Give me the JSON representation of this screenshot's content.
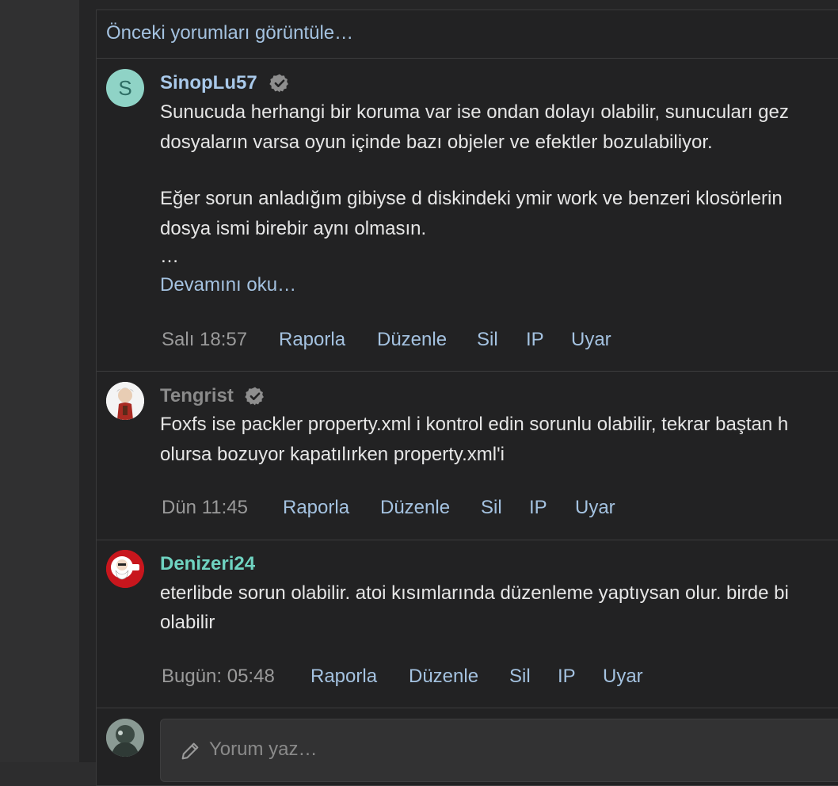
{
  "thread": {
    "previous_comments_link": "Önceki yorumları görüntüle…"
  },
  "comments": [
    {
      "username": "SinopLu57",
      "username_color": "#a9c9ea",
      "avatar_letter": "S",
      "verified": true,
      "body_lines": [
        "Sunucuda herhangi bir koruma var ise ondan dolayı olabilir, sunucuları gez",
        "dosyaların varsa oyun içinde bazı objeler ve efektler bozulabiliyor.",
        "Eğer sorun anladığım gibiyse d diskindeki ymir work ve benzeri klosörlerin",
        "dosya ismi birebir aynı olmasın.",
        "…"
      ],
      "read_more": "Devamını oku…",
      "time": "Salı 18:57",
      "actions": [
        "Raporla",
        "Düzenle",
        "Sil",
        "IP",
        "Uyar"
      ]
    },
    {
      "username": "Tengrist",
      "username_color": "#8a8a8a",
      "verified": true,
      "body_lines": [
        "Foxfs ise packler property.xml i kontrol edin sorunlu olabilir, tekrar baştan h",
        "olursa bozuyor kapatılırken property.xml'i"
      ],
      "time": "Dün 11:45",
      "actions": [
        "Raporla",
        "Düzenle",
        "Sil",
        "IP",
        "Uyar"
      ]
    },
    {
      "username": "Denizeri24",
      "username_color": "#6fd3c1",
      "verified": false,
      "body_lines": [
        "eterlibde sorun olabilir. atoi kısımlarında düzenleme yaptıysan olur. birde bi",
        "olabilir"
      ],
      "time": "Bugün: 05:48",
      "actions": [
        "Raporla",
        "Düzenle",
        "Sil",
        "IP",
        "Uyar"
      ]
    }
  ],
  "reply": {
    "placeholder": "Yorum yaz…"
  }
}
